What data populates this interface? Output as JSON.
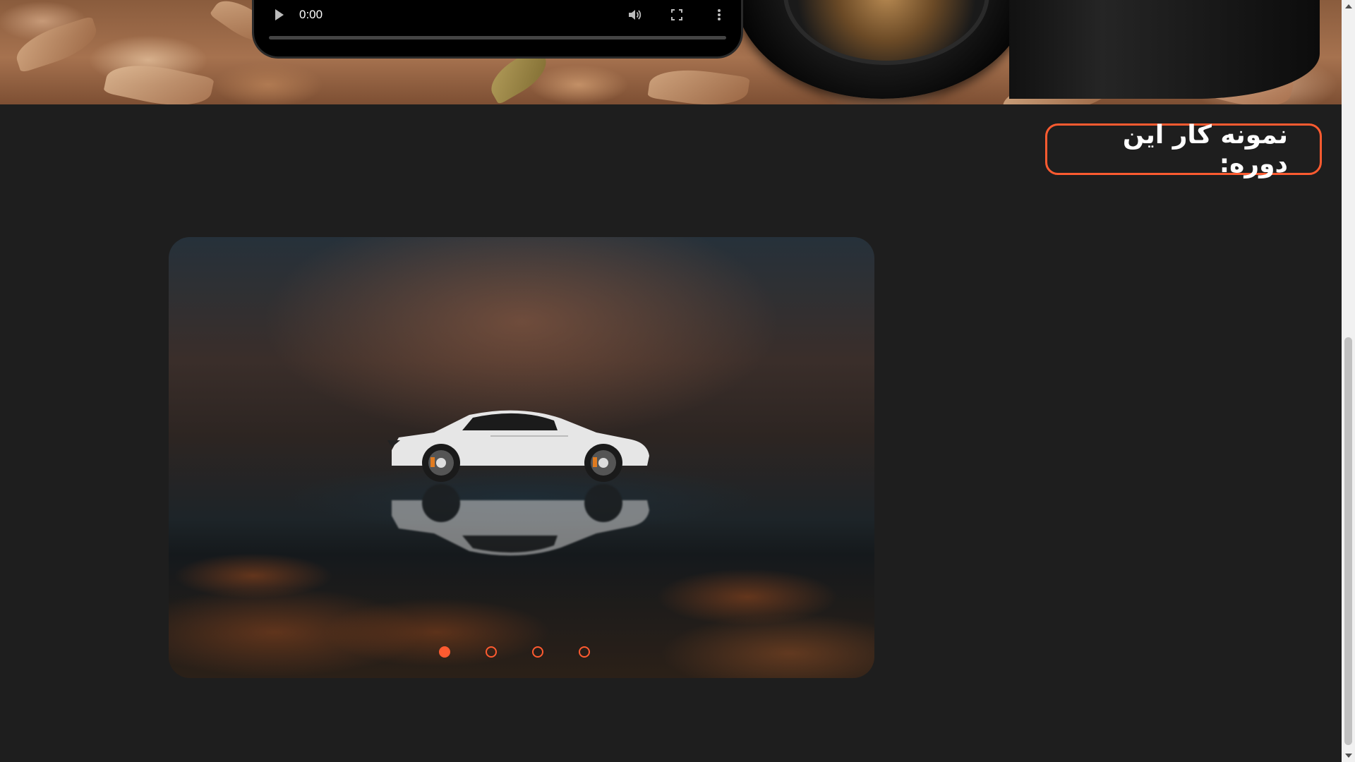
{
  "video": {
    "time": "0:00",
    "icons": [
      "play-icon",
      "volume-icon",
      "fullscreen-icon",
      "more-options-icon"
    ]
  },
  "section": {
    "title": "نمونه کار این دوره:"
  },
  "slider": {
    "image_subject": "car-photo",
    "total_slides": 4,
    "active_index": 0
  },
  "colors": {
    "accent": "#ff5b30",
    "background": "#1e1e1e"
  }
}
